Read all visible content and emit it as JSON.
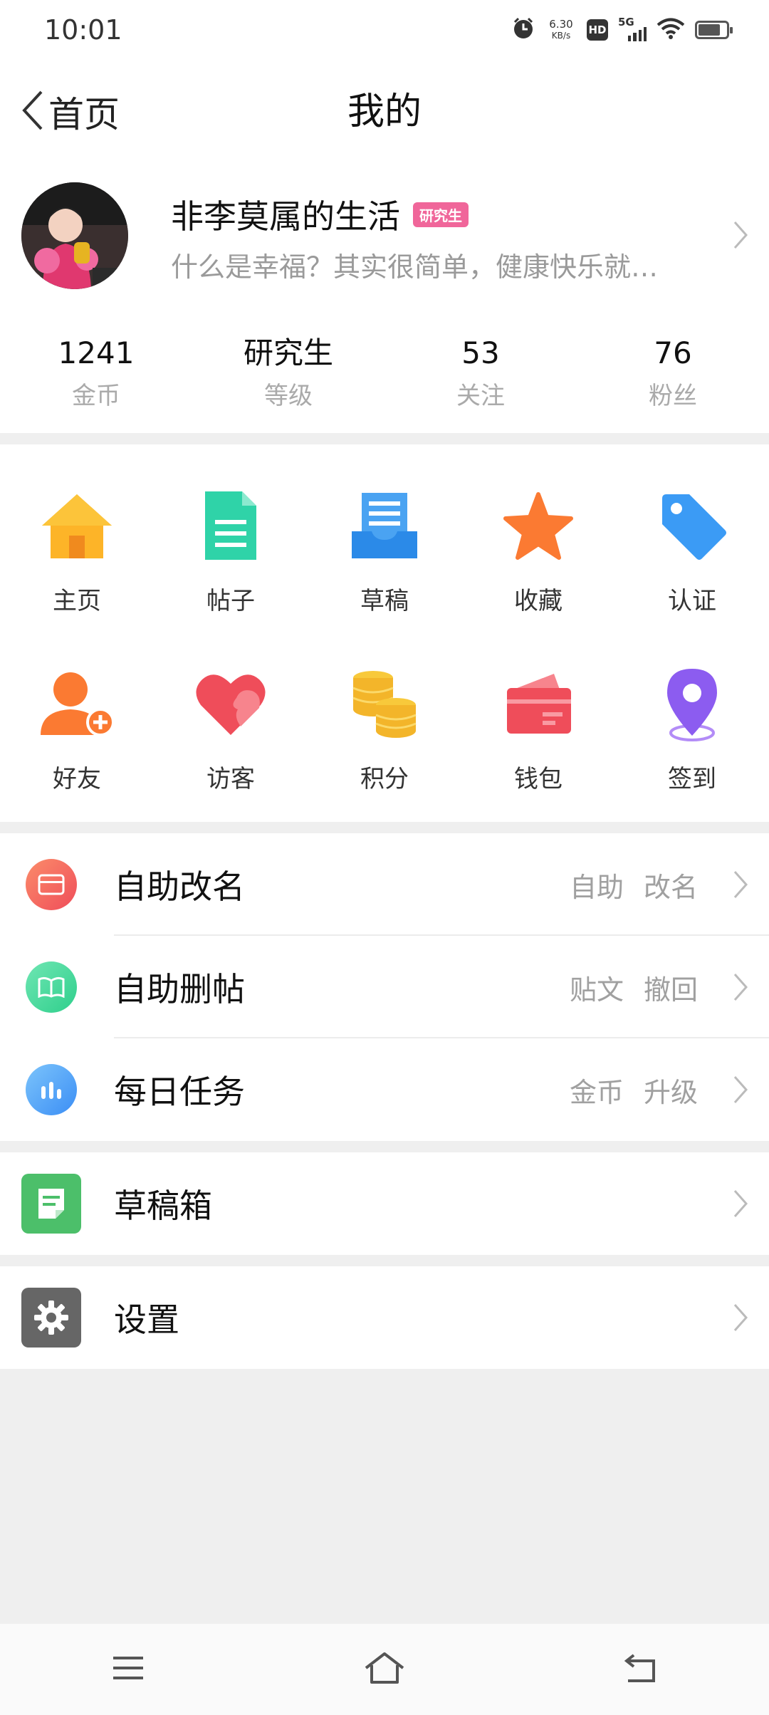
{
  "status_bar": {
    "time": "10:01",
    "net_speed_value": "6.30",
    "net_speed_unit": "KB/s",
    "hd_label": "HD",
    "network_label": "5G"
  },
  "nav": {
    "back_label": "首页",
    "title": "我的"
  },
  "profile": {
    "username": "非李莫属的生活",
    "level_badge": "研究生",
    "signature": "什么是幸福？其实很简单，健康快乐就…"
  },
  "stats": [
    {
      "value": "1241",
      "label": "金币"
    },
    {
      "value": "研究生",
      "label": "等级"
    },
    {
      "value": "53",
      "label": "关注"
    },
    {
      "value": "76",
      "label": "粉丝"
    }
  ],
  "grid": {
    "row1": [
      {
        "label": "主页",
        "icon": "home-icon"
      },
      {
        "label": "帖子",
        "icon": "document-icon"
      },
      {
        "label": "草稿",
        "icon": "draft-icon"
      },
      {
        "label": "收藏",
        "icon": "star-icon"
      },
      {
        "label": "认证",
        "icon": "tag-icon"
      }
    ],
    "row2": [
      {
        "label": "好友",
        "icon": "add-friend-icon"
      },
      {
        "label": "访客",
        "icon": "heart-icon"
      },
      {
        "label": "积分",
        "icon": "coins-icon"
      },
      {
        "label": "钱包",
        "icon": "wallet-icon"
      },
      {
        "label": "签到",
        "icon": "location-pin-icon"
      }
    ]
  },
  "list1": [
    {
      "label": "自助改名",
      "right1": "自助",
      "right2": "改名",
      "icon": "card-icon",
      "color": "#f46a5e"
    },
    {
      "label": "自助删帖",
      "right1": "贴文",
      "right2": "撤回",
      "icon": "book-icon",
      "color": "#3ed99b"
    },
    {
      "label": "每日任务",
      "right1": "金币",
      "right2": "升级",
      "icon": "bar-chart-icon",
      "color": "#4aa8f5"
    }
  ],
  "list2": {
    "label": "草稿箱",
    "icon": "note-icon",
    "color": "#4cbf6a"
  },
  "list3": {
    "label": "设置",
    "icon": "gear-icon",
    "color": "#666666"
  }
}
